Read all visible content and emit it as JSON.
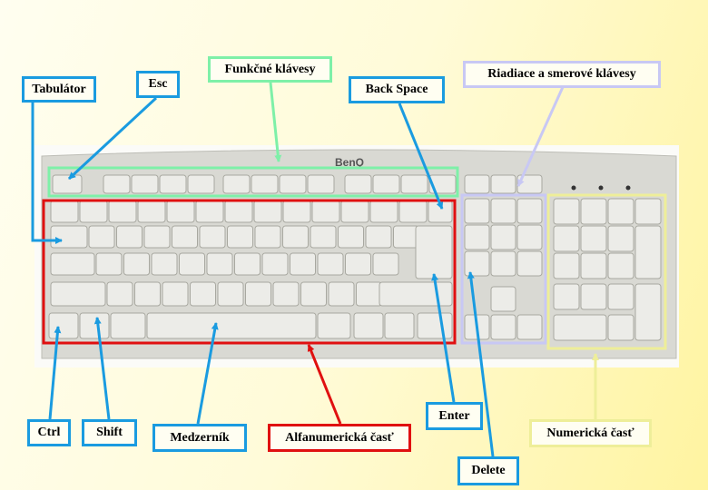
{
  "logo": "BenQ",
  "colors": {
    "blue": "#1a9be0",
    "green": "#7ef0a8",
    "red": "#e01010",
    "lavender": "#c8c8f4",
    "yellow": "#eeee99"
  },
  "labels": {
    "tabulator": "Tabulátor",
    "esc": "Esc",
    "function_keys": "Funkčné klávesy",
    "backspace": "Back Space",
    "control_arrow_keys": "Riadiace a smerové klávesy",
    "ctrl": "Ctrl",
    "shift": "Shift",
    "space": "Medzerník",
    "alphanumeric": "Alfanumerická časť",
    "enter": "Enter",
    "delete": "Delete",
    "numeric": "Numerická časť"
  }
}
